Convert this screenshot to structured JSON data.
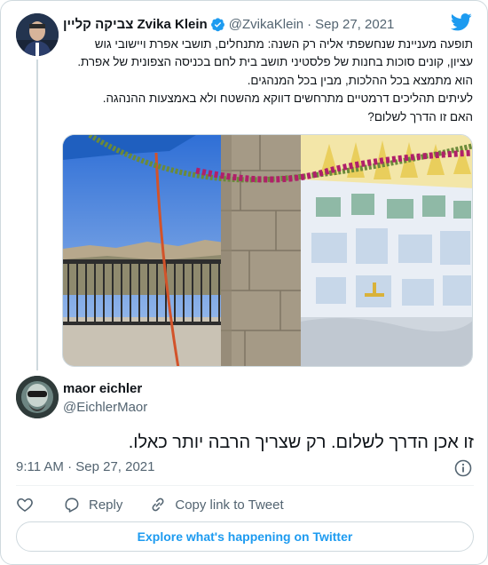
{
  "quoted_tweet": {
    "author_name": "צביקה קליין Zvika Klein",
    "handle": "@ZvikaKlein",
    "separator": "·",
    "date": "Sep 27, 2021",
    "text_lines": [
      "תופעה מעניינת שנחשפתי אליה רק השנה: מתנחלים, תושבי אפרת ויישובי גוש",
      "עציון, קונים סוכות בחנות של פלסטיני תושב בית לחם בכניסה הצפונית של אפרת.",
      "הוא מתמצא בכל ההלכות, מבין בכל המנהגים.",
      "לעיתים תהליכים דרמטיים מתרחשים דווקא מהשטח ולא באמצעות ההנהגה.",
      "האם זו הדרך לשלום?"
    ]
  },
  "reply_tweet": {
    "author_name": "maor eichler",
    "handle": "@EichlerMaor",
    "text": "זו אכן הדרך לשלום. רק שצריך הרבה יותר כאלו.",
    "timestamp": "9:11 AM · Sep 27, 2021"
  },
  "actions": {
    "reply_label": "Reply",
    "copy_link_label": "Copy link to Tweet"
  },
  "explore_button": "Explore what's happening on Twitter",
  "icons": [
    "verified-badge-icon",
    "twitter-logo-icon",
    "info-icon",
    "heart-icon",
    "reply-bubble-icon",
    "link-icon"
  ],
  "colors": {
    "accent": "#1d9bf0",
    "secondary_text": "#536471",
    "border": "#cfd9de"
  }
}
